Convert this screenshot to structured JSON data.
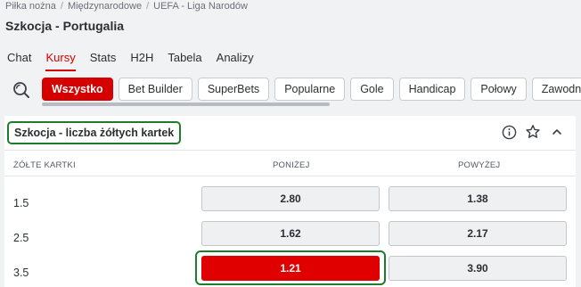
{
  "breadcrumb": [
    "Piłka nożna",
    "Międzynarodowe",
    "UEFA - Liga Narodów"
  ],
  "page_title": "Szkocja - Portugalia",
  "tabs": [
    {
      "label": "Chat",
      "active": false
    },
    {
      "label": "Kursy",
      "active": true
    },
    {
      "label": "Stats",
      "active": false
    },
    {
      "label": "H2H",
      "active": false
    },
    {
      "label": "Tabela",
      "active": false
    },
    {
      "label": "Analizy",
      "active": false
    }
  ],
  "filters": [
    {
      "label": "Wszystko",
      "active": true
    },
    {
      "label": "Bet Builder",
      "active": false
    },
    {
      "label": "SuperBets",
      "active": false
    },
    {
      "label": "Popularne",
      "active": false
    },
    {
      "label": "Gole",
      "active": false
    },
    {
      "label": "Handicap",
      "active": false
    },
    {
      "label": "Połowy",
      "active": false
    },
    {
      "label": "Zawodnicy",
      "active": false
    }
  ],
  "market": {
    "title": "Szkocja - liczba żółtych kartek",
    "columns": {
      "line": "ŻÓŁTE KARTKI",
      "under": "PONIŻEJ",
      "over": "POWYŻEJ"
    },
    "rows": [
      {
        "line": "1.5",
        "under": "2.80",
        "over": "1.38",
        "selected": null
      },
      {
        "line": "2.5",
        "under": "1.62",
        "over": "2.17",
        "selected": null
      },
      {
        "line": "3.5",
        "under": "1.21",
        "over": "3.90",
        "selected": "under"
      }
    ]
  },
  "colors": {
    "accent": "#d50000",
    "highlight": "#1e7d2c"
  },
  "icons": [
    "search-icon",
    "info-icon",
    "star-icon",
    "chevron-up-icon"
  ]
}
